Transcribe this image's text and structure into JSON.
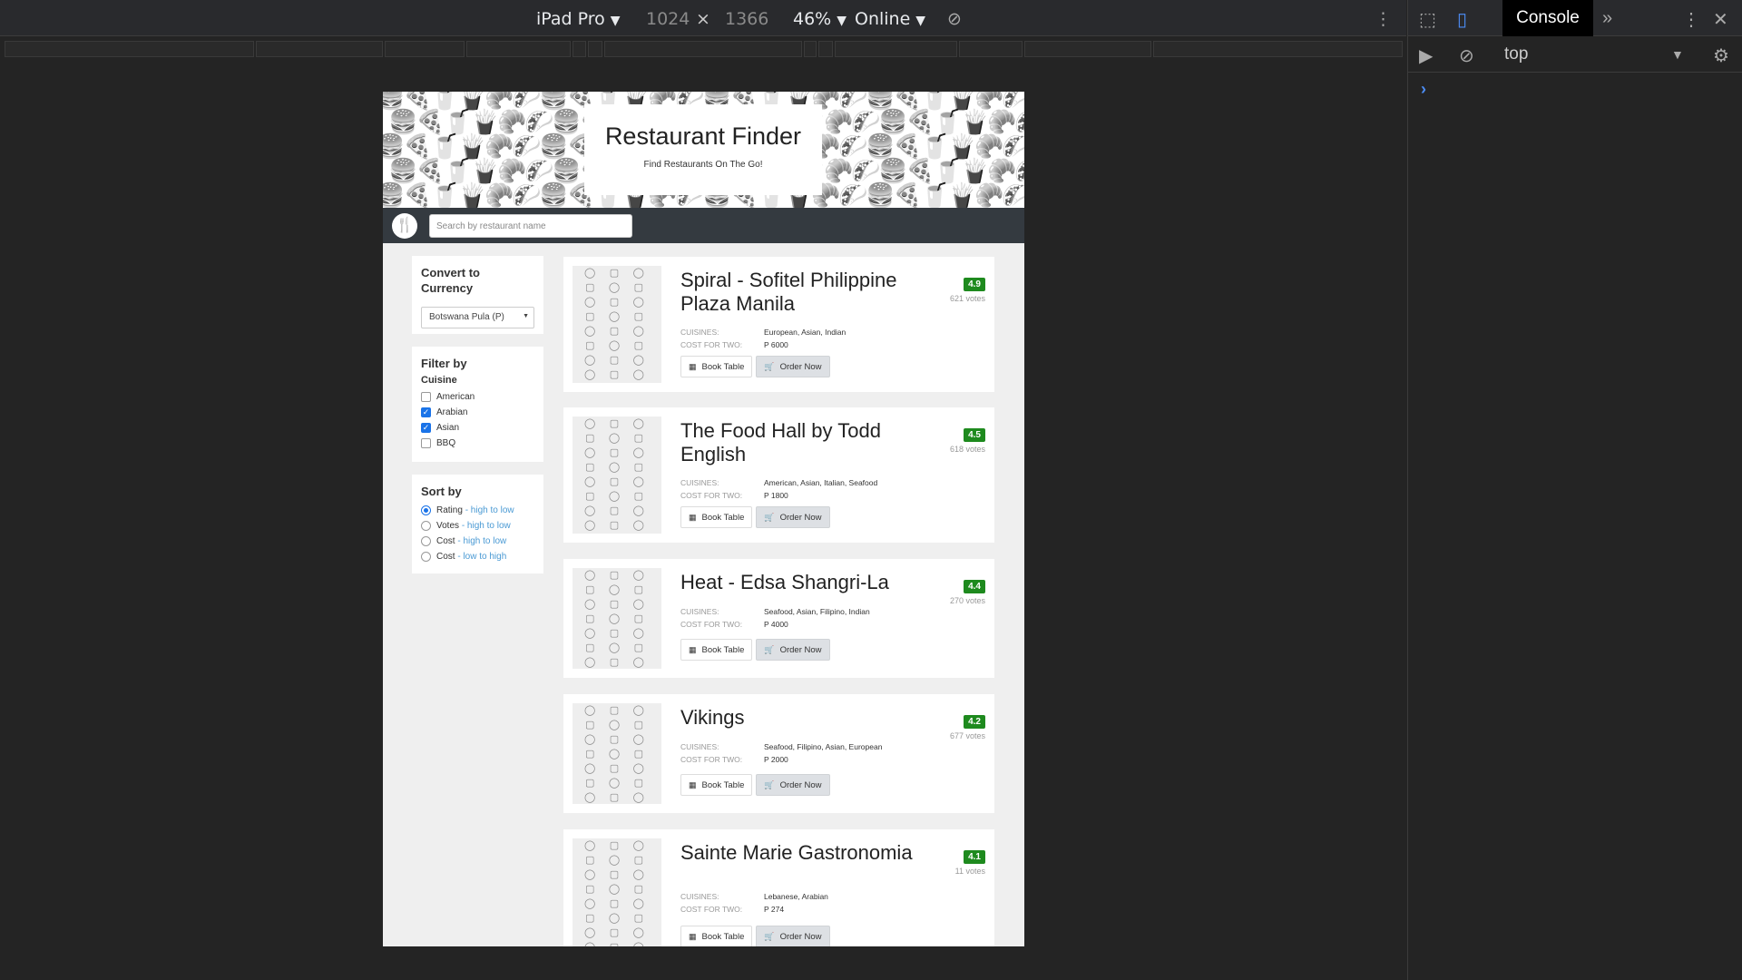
{
  "devtools": {
    "device": "iPad Pro",
    "width": "1024",
    "times": "×",
    "height": "1366",
    "zoom": "46%",
    "network": "Online",
    "console_tab": "Console",
    "context": "top"
  },
  "app": {
    "title": "Restaurant Finder",
    "subtitle": "Find Restaurants On The Go!",
    "search_placeholder": "Search by restaurant name"
  },
  "currency": {
    "heading": "Convert to Currency",
    "selected": "Botswana Pula (P)"
  },
  "filter": {
    "heading": "Filter by",
    "subheading": "Cuisine",
    "options": [
      {
        "label": "American",
        "checked": false
      },
      {
        "label": "Arabian",
        "checked": true
      },
      {
        "label": "Asian",
        "checked": true
      },
      {
        "label": "BBQ",
        "checked": false
      }
    ]
  },
  "sort": {
    "heading": "Sort by",
    "options": [
      {
        "label": "Rating",
        "hint": "- high to low",
        "selected": true
      },
      {
        "label": "Votes",
        "hint": "- high to low",
        "selected": false
      },
      {
        "label": "Cost",
        "hint": "- high to low",
        "selected": false
      },
      {
        "label": "Cost",
        "hint": "- low to high",
        "selected": false
      }
    ]
  },
  "labels": {
    "cuisines": "CUISINES:",
    "cost_for_two": "COST FOR TWO:",
    "book": "Book Table",
    "order": "Order Now"
  },
  "restaurants": [
    {
      "name": "Spiral - Sofitel Philippine Plaza Manila",
      "rating": "4.9",
      "votes": "621 votes",
      "cuisines": "European, Asian, Indian",
      "cost": "P 6000"
    },
    {
      "name": "The Food Hall by Todd English",
      "rating": "4.5",
      "votes": "618 votes",
      "cuisines": "American, Asian, Italian, Seafood",
      "cost": "P 1800"
    },
    {
      "name": "Heat - Edsa Shangri-La",
      "rating": "4.4",
      "votes": "270 votes",
      "cuisines": "Seafood, Asian, Filipino, Indian",
      "cost": "P 4000"
    },
    {
      "name": "Vikings",
      "rating": "4.2",
      "votes": "677 votes",
      "cuisines": "Seafood, Filipino, Asian, European",
      "cost": "P 2000"
    },
    {
      "name": "Sainte Marie Gastronomia",
      "rating": "4.1",
      "votes": "11 votes",
      "cuisines": "Lebanese, Arabian",
      "cost": "P 274"
    }
  ]
}
